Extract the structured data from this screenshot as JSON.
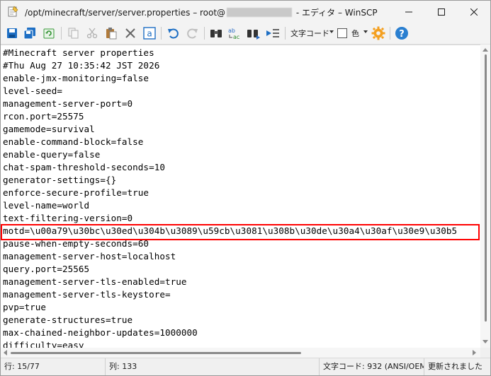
{
  "window": {
    "title_prefix": "/opt/minecraft/server/server.properties – root@",
    "title_suffix": " - エディタ – WinSCP"
  },
  "toolbar": {
    "encoding_label": "文字コード",
    "color_label": "色",
    "icons": [
      "save-icon",
      "save-all-icon",
      "reload-icon",
      "copy-icon",
      "cut-icon",
      "paste-icon",
      "delete-icon",
      "select-all-icon",
      "undo-icon",
      "redo-icon",
      "find-icon",
      "replace-icon",
      "find-next-icon",
      "goto-line-icon",
      "settings-icon",
      "help-icon"
    ]
  },
  "editor": {
    "lines": [
      "#Minecraft server properties",
      "#Thu Aug 27 10:35:42 JST 2026",
      "enable-jmx-monitoring=false",
      "level-seed=",
      "management-server-port=0",
      "rcon.port=25575",
      "gamemode=survival",
      "enable-command-block=false",
      "enable-query=false",
      "chat-spam-threshold-seconds=10",
      "generator-settings={}",
      "enforce-secure-profile=true",
      "level-name=world",
      "text-filtering-version=0",
      "motd=\\u00a79\\u30bc\\u30ed\\u304b\\u3089\\u59cb\\u3081\\u308b\\u30de\\u30a4\\u30af\\u30e9\\u30b5",
      "pause-when-empty-seconds=60",
      "management-server-host=localhost",
      "query.port=25565",
      "management-server-tls-enabled=true",
      "management-server-tls-keystore=",
      "pvp=true",
      "generate-structures=true",
      "max-chained-neighbor-updates=1000000",
      "difficulty=easy"
    ],
    "highlighted_line": 14
  },
  "status": {
    "line": "行: 15/77",
    "column": "列: 133",
    "encoding": "文字コード: 932  (ANSI/OEM",
    "modified": "更新されました"
  },
  "colors": {
    "highlight": "#ff0000",
    "icon_blue": "#1e6fc4",
    "settings_orange": "#f4a020",
    "help_blue": "#2a7fd0"
  }
}
